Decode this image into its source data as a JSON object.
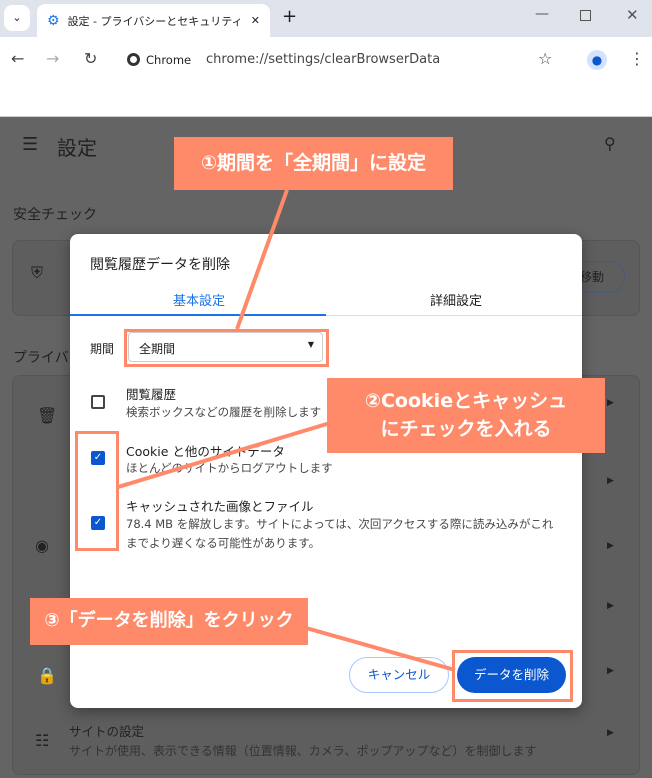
{
  "browser": {
    "tab_title": "設定 - プライバシーとセキュリティ",
    "site_label": "Chrome",
    "url": "chrome://settings/clearBrowserData"
  },
  "settings": {
    "title": "設定",
    "safety_check": "安全チェック",
    "privacy_heading": "プライバ",
    "move_button": "移動",
    "site_settings_title": "サイトの設定",
    "site_settings_desc": "サイトが使用、表示できる情報（位置情報、カメラ、ポップアップなど）を制御します"
  },
  "dialog": {
    "title": "閲覧履歴データを削除",
    "tabs": [
      {
        "label": "基本設定",
        "active": true
      },
      {
        "label": "詳細設定",
        "active": false
      }
    ],
    "period_label": "期間",
    "period_value": "全期間",
    "items": [
      {
        "title": "閲覧履歴",
        "desc": "検索ボックスなどの履歴を削除します",
        "checked": false
      },
      {
        "title": "Cookie と他のサイトデータ",
        "desc": "ほとんどのサイトからログアウトします",
        "checked": true
      },
      {
        "title": "キャッシュされた画像とファイル",
        "desc": "78.4 MB を解放します。サイトによっては、次回アクセスする際に読み込みがこれまでより遅くなる可能性があります。",
        "checked": true
      }
    ],
    "cancel": "キャンセル",
    "delete": "データを削除"
  },
  "annotations": {
    "step1": "①期間を「全期間」に設定",
    "step2a": "②Cookieとキャッシュ",
    "step2b": "にチェックを入れる",
    "step3": "③「データを削除」をクリック"
  },
  "colors": {
    "accent": "#0b57d0",
    "callout": "#ff8a6a",
    "overlay": "#646464"
  }
}
